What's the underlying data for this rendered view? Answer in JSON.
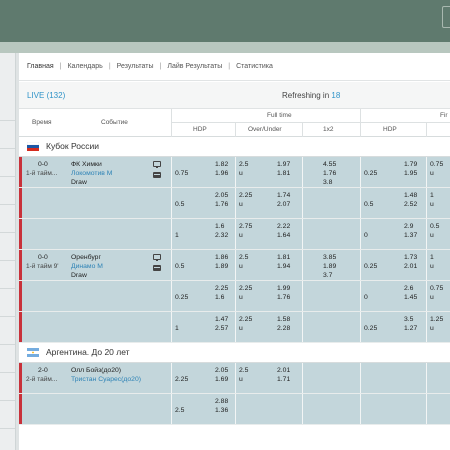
{
  "nav": {
    "items": [
      "Главная",
      "Календарь",
      "Результаты",
      "Лайв Результаты",
      "Статистика"
    ]
  },
  "live": {
    "label": "LIVE (132)",
    "refresh_prefix": "Refreshing in",
    "refresh_seconds": "18"
  },
  "header": {
    "time": "Время",
    "event": "Событие",
    "fulltime": "Full time",
    "firsthalf": "Fir",
    "hdp": "HDP",
    "ou": "Over/Under",
    "x12": "1x2",
    "hdp2": "HDP"
  },
  "leagues": [
    {
      "name": "Кубок России",
      "flag": "russia-flag-icon"
    },
    {
      "name": "Аргентина. До 20 лет",
      "flag": "argentina-flag-icon"
    }
  ],
  "matches": [
    {
      "score": "0-0",
      "period": "1-й тайм...",
      "home": "ФК Химки",
      "away": "Локомотив М",
      "draw": "Draw",
      "lines": [
        {
          "hdp": "0.75",
          "hdp_h": "1.82",
          "hdp_a": "1.96",
          "ou": "2.5",
          "ou_u": "u",
          "ou_o": "1.97",
          "ou_uo": "1.81",
          "x1": "4.55",
          "x2": "1.76",
          "xd": "3.8",
          "fh_hdp": "0.25",
          "fh_h": "1.79",
          "fh_a": "1.95",
          "fh_ou": "0.75",
          "fh_u": "u"
        },
        {
          "hdp": "0.5",
          "hdp_h": "2.05",
          "hdp_a": "1.76",
          "ou": "2.25",
          "ou_u": "u",
          "ou_o": "1.74",
          "ou_uo": "2.07",
          "x1": "",
          "x2": "",
          "xd": "",
          "fh_hdp": "0.5",
          "fh_h": "1.48",
          "fh_a": "2.52",
          "fh_ou": "1",
          "fh_u": "u"
        },
        {
          "hdp": "1",
          "hdp_h": "1.6",
          "hdp_a": "2.32",
          "ou": "2.75",
          "ou_u": "u",
          "ou_o": "2.22",
          "ou_uo": "1.64",
          "x1": "",
          "x2": "",
          "xd": "",
          "fh_hdp": "0",
          "fh_h": "2.9",
          "fh_a": "1.37",
          "fh_ou": "0.5",
          "fh_u": "u"
        }
      ]
    },
    {
      "score": "0-0",
      "period": "1-й тайм 9'",
      "home": "Оренбург",
      "away": "Динамо М",
      "draw": "Draw",
      "lines": [
        {
          "hdp": "0.5",
          "hdp_h": "1.86",
          "hdp_a": "1.89",
          "ou": "2.5",
          "ou_u": "u",
          "ou_o": "1.81",
          "ou_uo": "1.94",
          "x1": "3.85",
          "x2": "1.89",
          "xd": "3.7",
          "fh_hdp": "0.25",
          "fh_h": "1.73",
          "fh_a": "2.01",
          "fh_ou": "1",
          "fh_u": "u"
        },
        {
          "hdp": "0.25",
          "hdp_h": "2.25",
          "hdp_a": "1.6",
          "ou": "2.25",
          "ou_u": "u",
          "ou_o": "1.99",
          "ou_uo": "1.76",
          "x1": "",
          "x2": "",
          "xd": "",
          "fh_hdp": "0",
          "fh_h": "2.6",
          "fh_a": "1.45",
          "fh_ou": "0.75",
          "fh_u": "u"
        },
        {
          "hdp": "1",
          "hdp_h": "1.47",
          "hdp_a": "2.57",
          "ou": "2.25",
          "ou_u": "u",
          "ou_o": "1.58",
          "ou_uo": "2.28",
          "x1": "",
          "x2": "",
          "xd": "",
          "fh_hdp": "0.25",
          "fh_h": "3.5",
          "fh_a": "1.27",
          "fh_ou": "1.25",
          "fh_u": "u"
        }
      ]
    },
    {
      "score": "2-0",
      "period": "2-й тайм...",
      "home": "Олл Бойз(до20)",
      "away": "Тристан Суарес(до20)",
      "draw": "",
      "lines": [
        {
          "hdp": "2.25",
          "hdp_h": "2.05",
          "hdp_a": "1.69",
          "ou": "2.5",
          "ou_u": "u",
          "ou_o": "2.01",
          "ou_uo": "1.71",
          "x1": "",
          "x2": "",
          "xd": "",
          "fh_hdp": "",
          "fh_h": "",
          "fh_a": "",
          "fh_ou": "",
          "fh_u": ""
        },
        {
          "hdp": "2.5",
          "hdp_h": "2.88",
          "hdp_a": "1.36",
          "ou": "",
          "ou_u": "",
          "ou_o": "",
          "ou_uo": "",
          "x1": "",
          "x2": "",
          "xd": "",
          "fh_hdp": "",
          "fh_h": "",
          "fh_a": "",
          "fh_ou": "",
          "fh_u": ""
        }
      ]
    }
  ]
}
